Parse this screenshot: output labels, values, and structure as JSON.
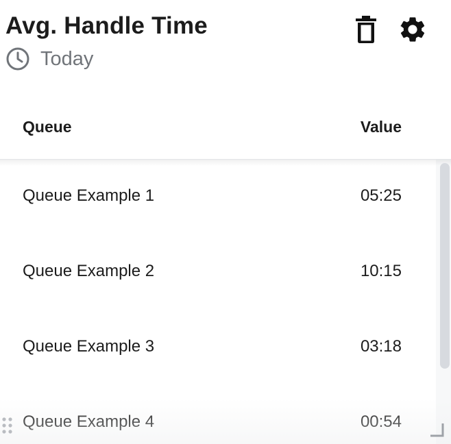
{
  "widget": {
    "title": "Avg. Handle Time",
    "period": "Today",
    "icons": {
      "period": "clock-icon",
      "delete": "trash-icon",
      "settings": "gear-icon",
      "drag": "drag-handle-icon",
      "resize": "resize-corner-icon"
    }
  },
  "table": {
    "headers": {
      "queue": "Queue",
      "value": "Value"
    },
    "rows": [
      {
        "queue": "Queue Example 1",
        "value": "05:25"
      },
      {
        "queue": "Queue Example 2",
        "value": "10:15"
      },
      {
        "queue": "Queue Example 3",
        "value": "03:18"
      },
      {
        "queue": "Queue Example 4",
        "value": "00:54"
      }
    ]
  },
  "colors": {
    "text": "#1c1c1c",
    "muted": "#707479",
    "divider": "#e3e5e8",
    "scrollbar": "#d7dadf"
  }
}
